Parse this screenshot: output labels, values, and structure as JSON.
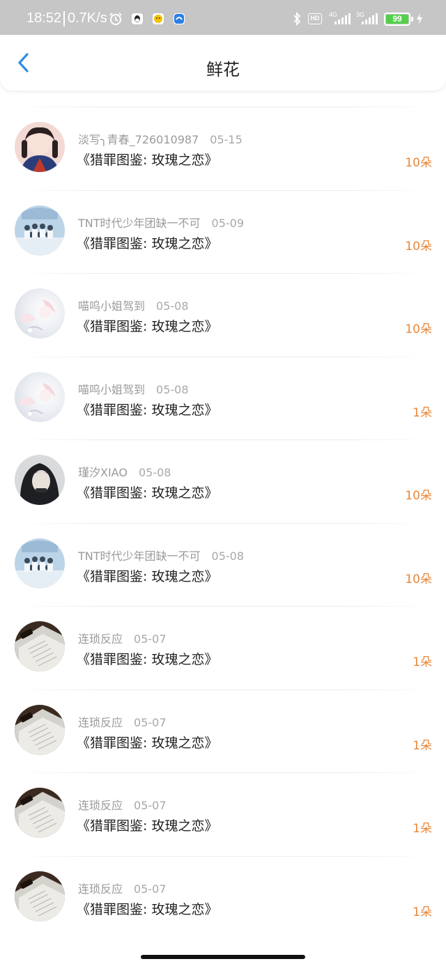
{
  "status_bar": {
    "time": "18:52",
    "net_speed": "0.7K/s",
    "hd_label": "HD",
    "network_1": "4G",
    "network_2": "3G",
    "battery": "99",
    "battery_color": "#51d14a"
  },
  "header": {
    "title": "鲜花",
    "back_icon": "chevron-left-icon",
    "accent": "#2f8de4"
  },
  "list": {
    "items": [
      {
        "user": "淡写╮青春_726010987",
        "date": "05-15",
        "book": "《猎罪图鉴: 玫瑰之恋》",
        "count": "10朵",
        "avatar": "girl-portrait"
      },
      {
        "user": "TNT时代少年团缺一不可",
        "date": "05-09",
        "book": "《猎罪图鉴: 玫瑰之恋》",
        "count": "10朵",
        "avatar": "group-photo"
      },
      {
        "user": "喵呜小姐驾到",
        "date": "05-08",
        "book": "《猎罪图鉴: 玫瑰之恋》",
        "count": "10朵",
        "avatar": "pastel-art"
      },
      {
        "user": "喵呜小姐驾到",
        "date": "05-08",
        "book": "《猎罪图鉴: 玫瑰之恋》",
        "count": "1朵",
        "avatar": "pastel-art"
      },
      {
        "user": "瑾汐XIAO",
        "date": "05-08",
        "book": "《猎罪图鉴: 玫瑰之恋》",
        "count": "10朵",
        "avatar": "dark-hood"
      },
      {
        "user": "TNT时代少年团缺一不可",
        "date": "05-08",
        "book": "《猎罪图鉴: 玫瑰之恋》",
        "count": "10朵",
        "avatar": "group-photo"
      },
      {
        "user": "连琐反应",
        "date": "05-07",
        "book": "《猎罪图鉴: 玫瑰之恋》",
        "count": "1朵",
        "avatar": "open-book"
      },
      {
        "user": "连琐反应",
        "date": "05-07",
        "book": "《猎罪图鉴: 玫瑰之恋》",
        "count": "1朵",
        "avatar": "open-book"
      },
      {
        "user": "连琐反应",
        "date": "05-07",
        "book": "《猎罪图鉴: 玫瑰之恋》",
        "count": "1朵",
        "avatar": "open-book"
      },
      {
        "user": "连琐反应",
        "date": "05-07",
        "book": "《猎罪图鉴: 玫瑰之恋》",
        "count": "1朵",
        "avatar": "open-book"
      }
    ]
  },
  "colors": {
    "count": "#e8873a",
    "meta": "#9a9a9a",
    "title": "#222222"
  }
}
